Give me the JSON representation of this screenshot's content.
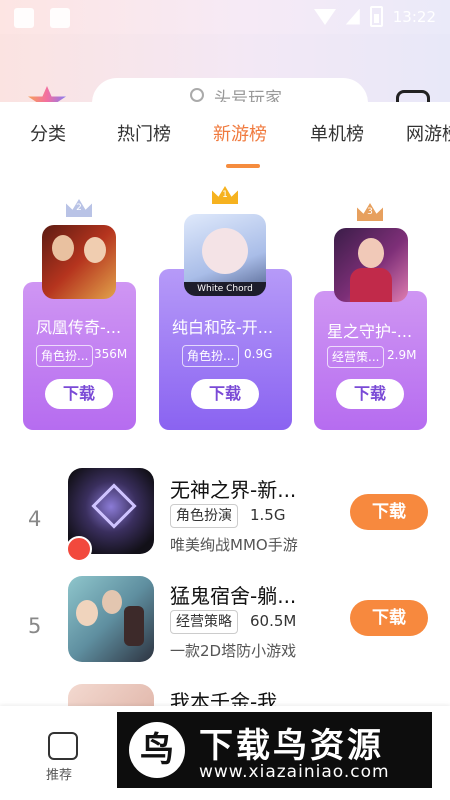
{
  "status_bar": {
    "time": "13:22"
  },
  "search": {
    "placeholder": "头号玩家"
  },
  "tabs": [
    {
      "label": "分类"
    },
    {
      "label": "热门榜"
    },
    {
      "label": "新游榜",
      "active": true
    },
    {
      "label": "单机榜"
    },
    {
      "label": "网游榜"
    }
  ],
  "top3": [
    {
      "rank": "2",
      "title": "凤凰传奇-...",
      "tag": "角色扮...",
      "size": "356M",
      "button": "下载"
    },
    {
      "rank": "1",
      "title": "纯白和弦-开...",
      "tag": "角色扮...",
      "size": "0.9G",
      "button": "下载",
      "icon_caption": "White Chord"
    },
    {
      "rank": "3",
      "title": "星之守护-...",
      "tag": "经营策...",
      "size": "2.9M",
      "button": "下载"
    }
  ],
  "list": [
    {
      "rank": "4",
      "title": "无神之界-新...",
      "tag": "角色扮演",
      "size": "1.5G",
      "desc": "唯美绚战MMO手游",
      "button": "下载"
    },
    {
      "rank": "5",
      "title": "猛鬼宿舍-躺...",
      "tag": "经营策略",
      "size": "60.5M",
      "desc": "一款2D塔防小游戏",
      "button": "下载"
    },
    {
      "rank": "",
      "title": "我本千金-我..."
    }
  ],
  "bottom_nav": {
    "label": "推荐"
  },
  "watermark": {
    "mark": "鸟",
    "title": "下载鸟资源",
    "url": "www.xiazainiao.com"
  },
  "colors": {
    "accent": "#f7893e",
    "card_purple": "#b66cf0",
    "card_violet": "#8a63f1"
  }
}
